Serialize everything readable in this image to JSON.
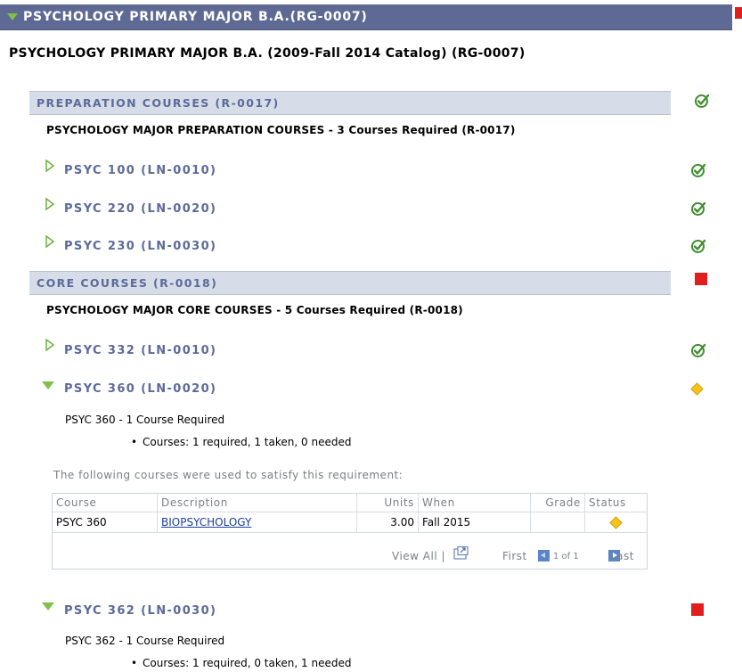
{
  "header": {
    "title": "PSYCHOLOGY PRIMARY MAJOR B.A.(RG-0007)"
  },
  "main_title": "PSYCHOLOGY PRIMARY MAJOR B.A. (2009-Fall 2014 Catalog) (RG-0007)",
  "sections": [
    {
      "title": "PREPARATION COURSES (R-0017)",
      "description": "PSYCHOLOGY MAJOR PREPARATION COURSES - 3 Courses Required (R-0017)",
      "status": "check-icon",
      "lines": [
        {
          "label": "PSYC 100 (LN-0010)",
          "status": "check-icon"
        },
        {
          "label": "PSYC 220 (LN-0020)",
          "status": "check-icon"
        },
        {
          "label": "PSYC 230 (LN-0030)",
          "status": "check-icon"
        }
      ]
    },
    {
      "title": "CORE COURSES (R-0018)",
      "description": "PSYCHOLOGY MAJOR CORE COURSES - 5 Courses Required (R-0018)",
      "status": "red-square-icon",
      "lines": [
        {
          "label": "PSYC 332 (LN-0010)",
          "status": "check-icon"
        },
        {
          "label": "PSYC 360 (LN-0020)",
          "status": "yellow-diamond-icon",
          "requirement": "PSYC 360 - 1 Course Required",
          "courses_info": "Courses: 1 required, 1 taken, 0 needed",
          "used_text": "The following courses were used to satisfy this requirement:",
          "table": {
            "headers": [
              "Course",
              "Description",
              "Units",
              "When",
              "Grade",
              "Status"
            ],
            "rows": [
              {
                "course": "PSYC 360",
                "description": "BIOPSYCHOLOGY",
                "units": "3.00",
                "when": "Fall 2015",
                "grade": "",
                "status": "yellow-diamond-icon"
              }
            ],
            "footer": {
              "view_all": "View All |",
              "first": "First",
              "page_info": "1 of 1",
              "last": "Last"
            }
          }
        },
        {
          "label": "PSYC 362 (LN-0030)",
          "status": "red-square-icon",
          "requirement": "PSYC 362 - 1 Course Required",
          "courses_info": "Courses: 1 required, 0 taken, 1 needed"
        }
      ]
    }
  ],
  "colors": {
    "header_bar": "#5e6a93",
    "section_bar": "#d7dde8",
    "label_blue": "#5b6a99",
    "green": "#7ec24a",
    "red": "#e11d1d",
    "yellow": "#f5c518"
  }
}
